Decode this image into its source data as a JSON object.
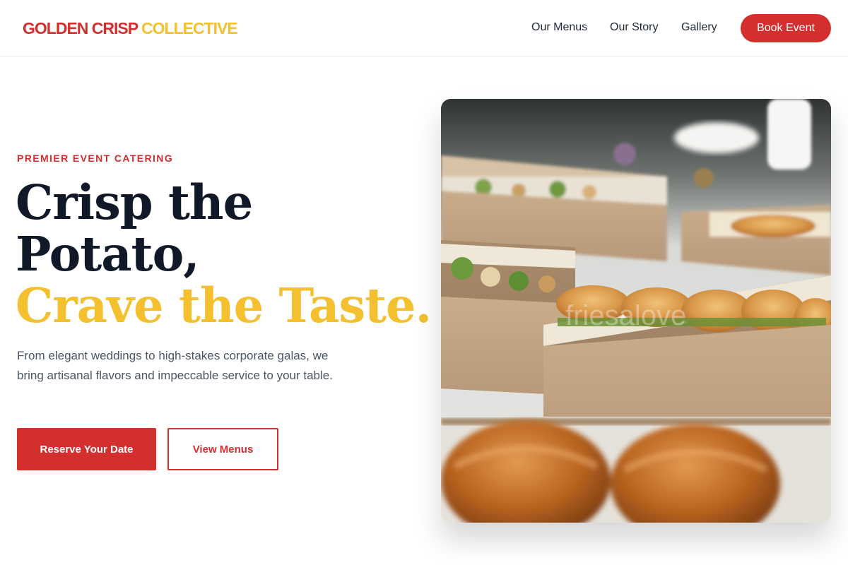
{
  "header": {
    "logo": {
      "word1": "GOLDEN CRISP",
      "word2": "COLLECTIVE"
    },
    "nav": [
      {
        "label": "Our Menus"
      },
      {
        "label": "Our Story"
      },
      {
        "label": "Gallery"
      }
    ],
    "cta_label": "Book Event"
  },
  "hero": {
    "eyebrow": "PREMIER EVENT CATERING",
    "headline_line1": "Crisp the",
    "headline_line2": "Potato,",
    "headline_accent": "Crave the Taste.",
    "subtext": "From elegant weddings to high-stakes corporate galas, we bring artisanal flavors and impeccable service to your table.",
    "primary_button": "Reserve Your Date",
    "secondary_button": "View Menus",
    "image_watermark": "friesalove"
  },
  "colors": {
    "brand_red": "#d42f2f",
    "brand_gold": "#f4c02f",
    "headline_dark": "#111827"
  }
}
